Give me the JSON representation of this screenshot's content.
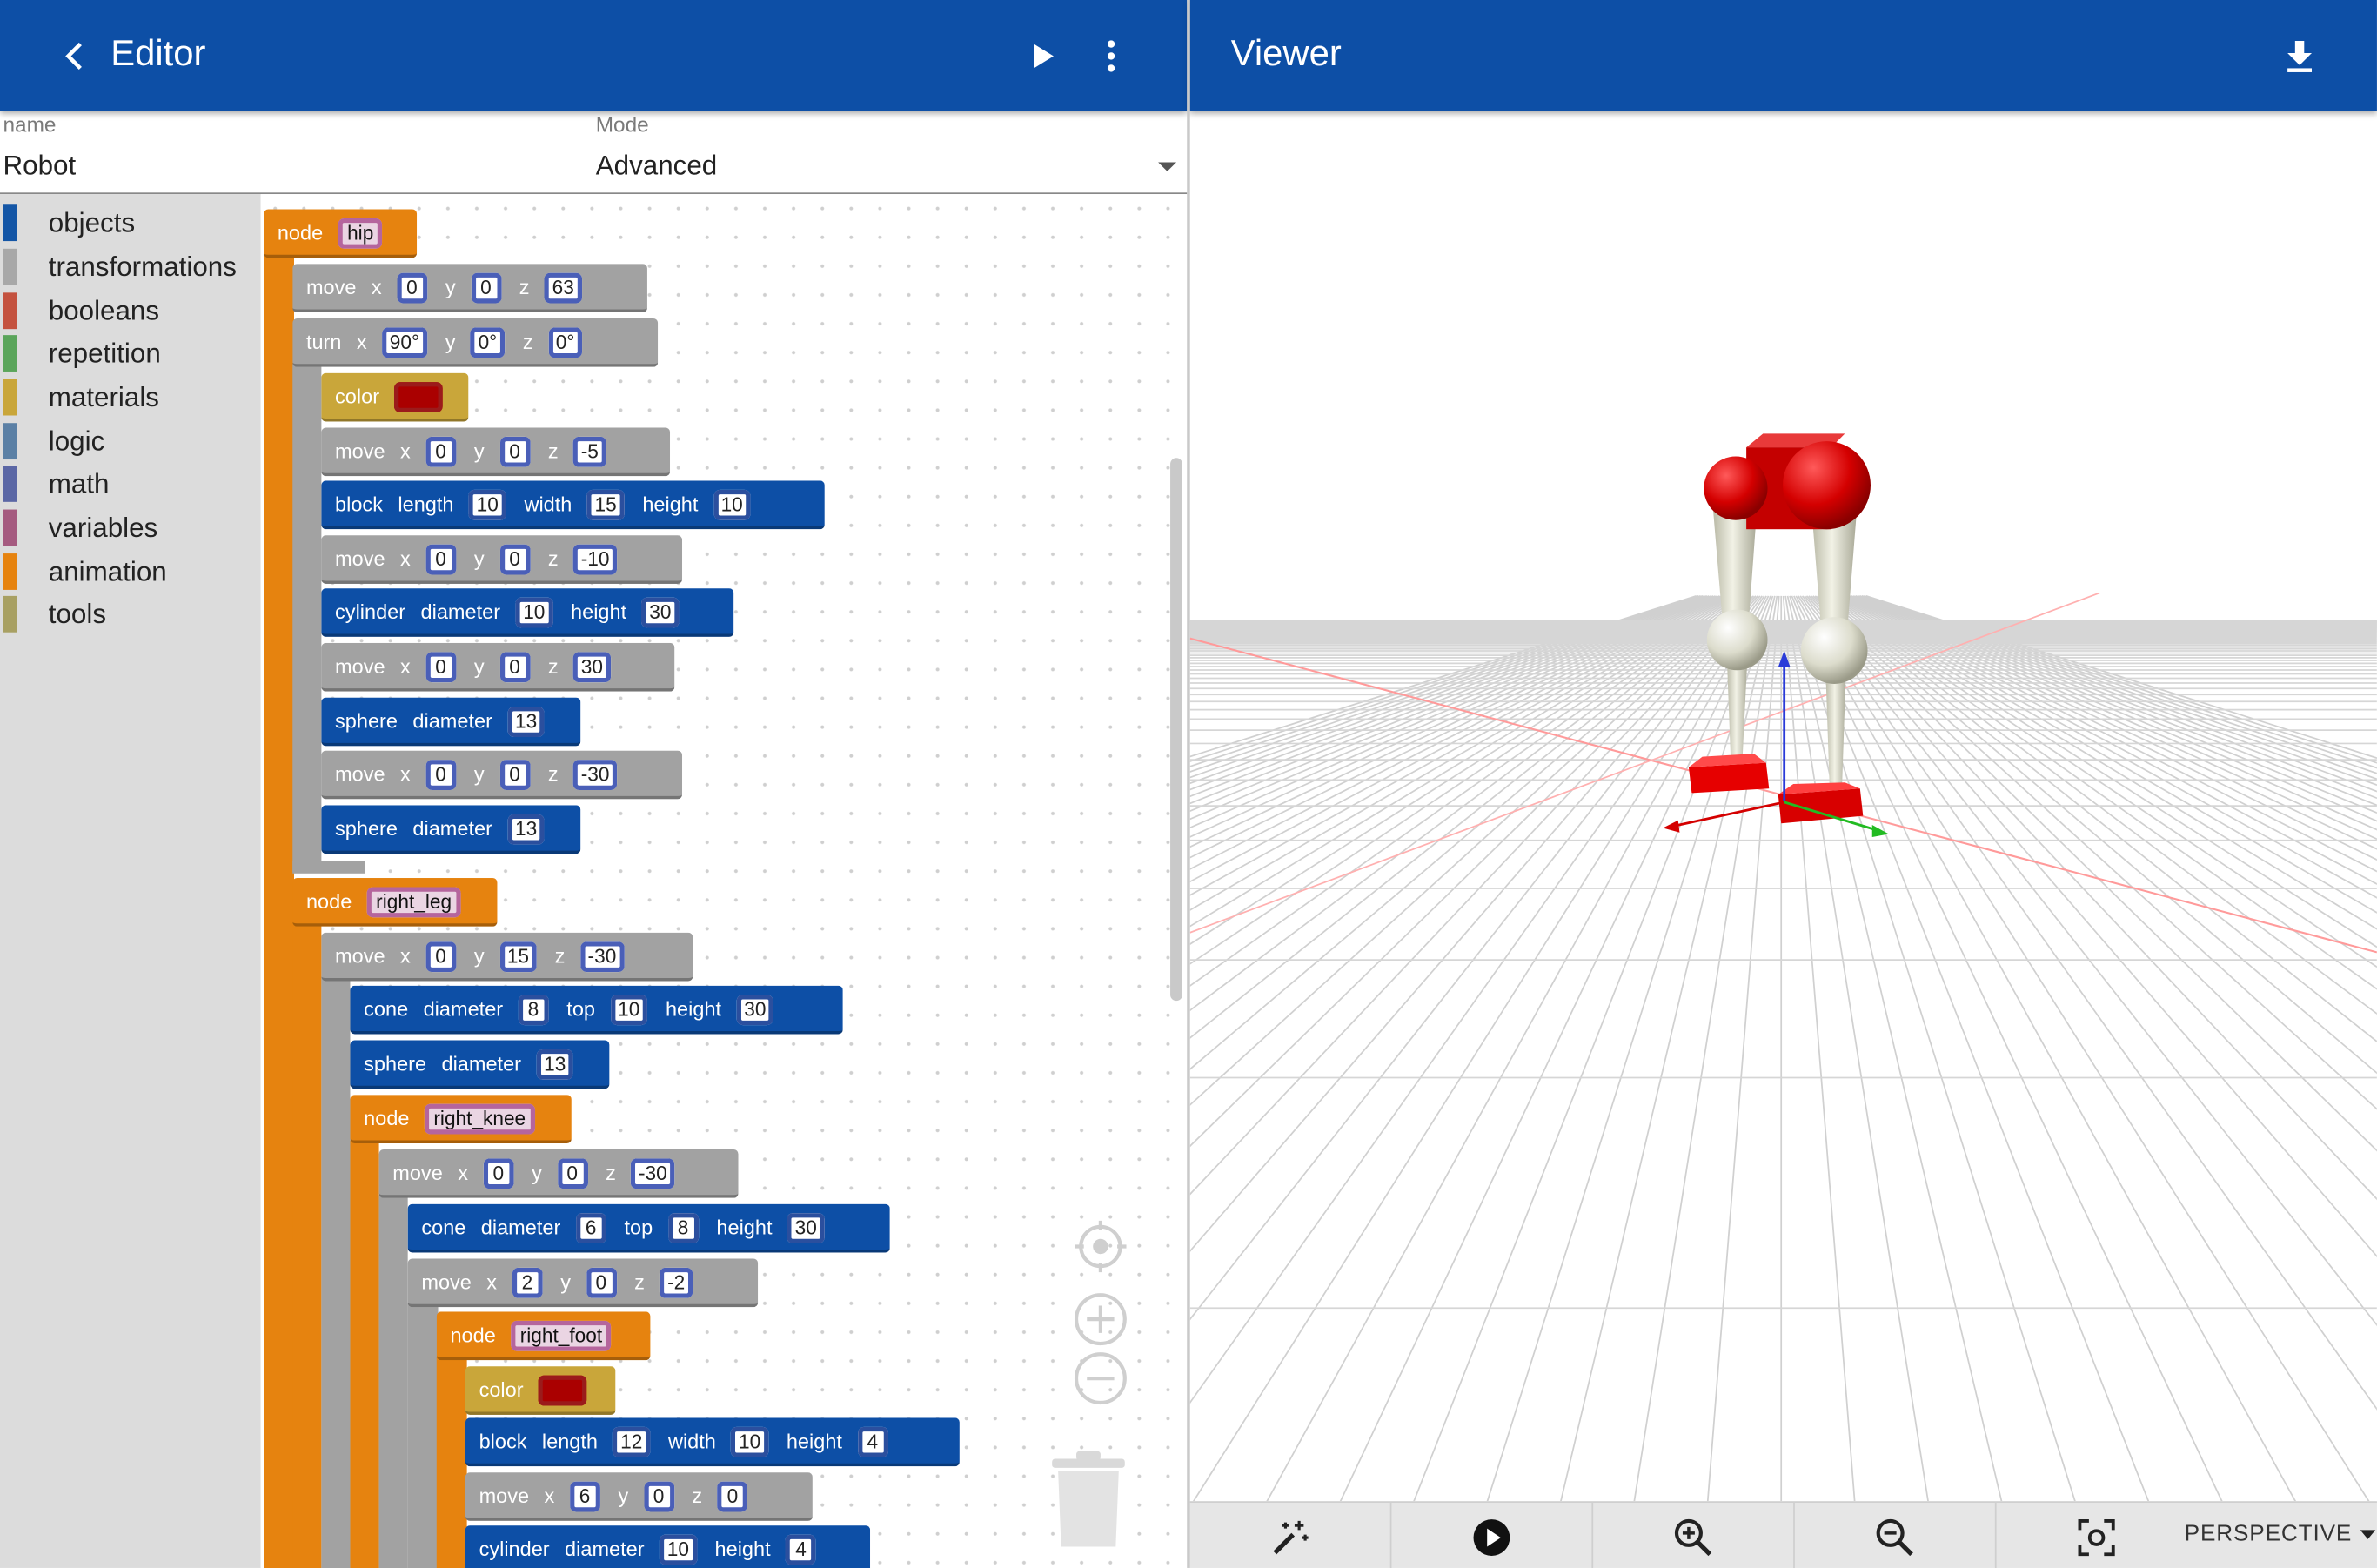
{
  "editor": {
    "title": "Editor",
    "back_icon": "chevron-left-icon",
    "run_icon": "play-icon",
    "menu_icon": "more-vert-icon"
  },
  "viewer": {
    "title": "Viewer",
    "download_icon": "download-icon"
  },
  "fields": {
    "name_label": "name",
    "name_value": "Robot",
    "mode_label": "Mode",
    "mode_value": "Advanced"
  },
  "toolbox": {
    "categories": [
      {
        "label": "objects",
        "color": "#1456a6"
      },
      {
        "label": "transformations",
        "color": "#a8a8a8"
      },
      {
        "label": "booleans",
        "color": "#c4523f"
      },
      {
        "label": "repetition",
        "color": "#5ba55b"
      },
      {
        "label": "materials",
        "color": "#c9a63a"
      },
      {
        "label": "logic",
        "color": "#5b80a5"
      },
      {
        "label": "math",
        "color": "#5b67a5"
      },
      {
        "label": "variables",
        "color": "#a55b80"
      },
      {
        "label": "animation",
        "color": "#e6830f"
      },
      {
        "label": "tools",
        "color": "#a8a063"
      }
    ]
  },
  "blocks": {
    "node_kw": "node",
    "move_kw": "move",
    "turn_kw": "turn",
    "color_kw": "color",
    "block_kw": "block",
    "cylinder_kw": "cylinder",
    "sphere_kw": "sphere",
    "cone_kw": "cone",
    "x": "x",
    "y": "y",
    "z": "z",
    "length": "length",
    "width": "width",
    "height": "height",
    "diameter": "diameter",
    "top": "top",
    "hip": "hip",
    "right_leg": "right_leg",
    "right_knee": "right_knee",
    "right_foot": "right_foot",
    "v": {
      "b2x": "0",
      "b2y": "0",
      "b2z": "63",
      "b3x": "90°",
      "b3y": "0°",
      "b3z": "0°",
      "b5x": "0",
      "b5y": "0",
      "b5z": "-5",
      "b6l": "10",
      "b6w": "15",
      "b6h": "10",
      "b7x": "0",
      "b7y": "0",
      "b7z": "-10",
      "b8d": "10",
      "b8h": "30",
      "b9x": "0",
      "b9y": "0",
      "b9z": "30",
      "b10d": "13",
      "b11x": "0",
      "b11y": "0",
      "b11z": "-30",
      "b12d": "13",
      "b14x": "0",
      "b14y": "15",
      "b14z": "-30",
      "b15d": "8",
      "b15t": "10",
      "b15h": "30",
      "b16d": "13",
      "b18x": "0",
      "b18y": "0",
      "b18z": "-30",
      "b19d": "6",
      "b19t": "8",
      "b19h": "30",
      "b20x": "2",
      "b20y": "0",
      "b20z": "-2",
      "b23l": "12",
      "b23w": "10",
      "b23h": "4",
      "b24x": "6",
      "b24y": "0",
      "b24z": "0",
      "b25d": "10",
      "b25h": "4"
    }
  },
  "workspace_icons": {
    "recenter": "target-icon",
    "zoom_in": "plus-circle-icon",
    "zoom_out": "minus-circle-icon",
    "trash": "trash-icon"
  },
  "viewer_toolbar": {
    "wand": "magic-wand-icon",
    "play": "play-circle-icon",
    "zoom_in": "zoom-in-icon",
    "zoom_out": "zoom-out-icon",
    "screenshot": "screenshot-icon",
    "camera_mode": "PERSPECTIVE"
  },
  "colors": {
    "appbar": "#0d4fa6",
    "node": "#e6830f",
    "transform": "#a2a2a2",
    "object": "#0d4fa6",
    "material": "#c9a63a",
    "robot_red": "#d40000"
  }
}
